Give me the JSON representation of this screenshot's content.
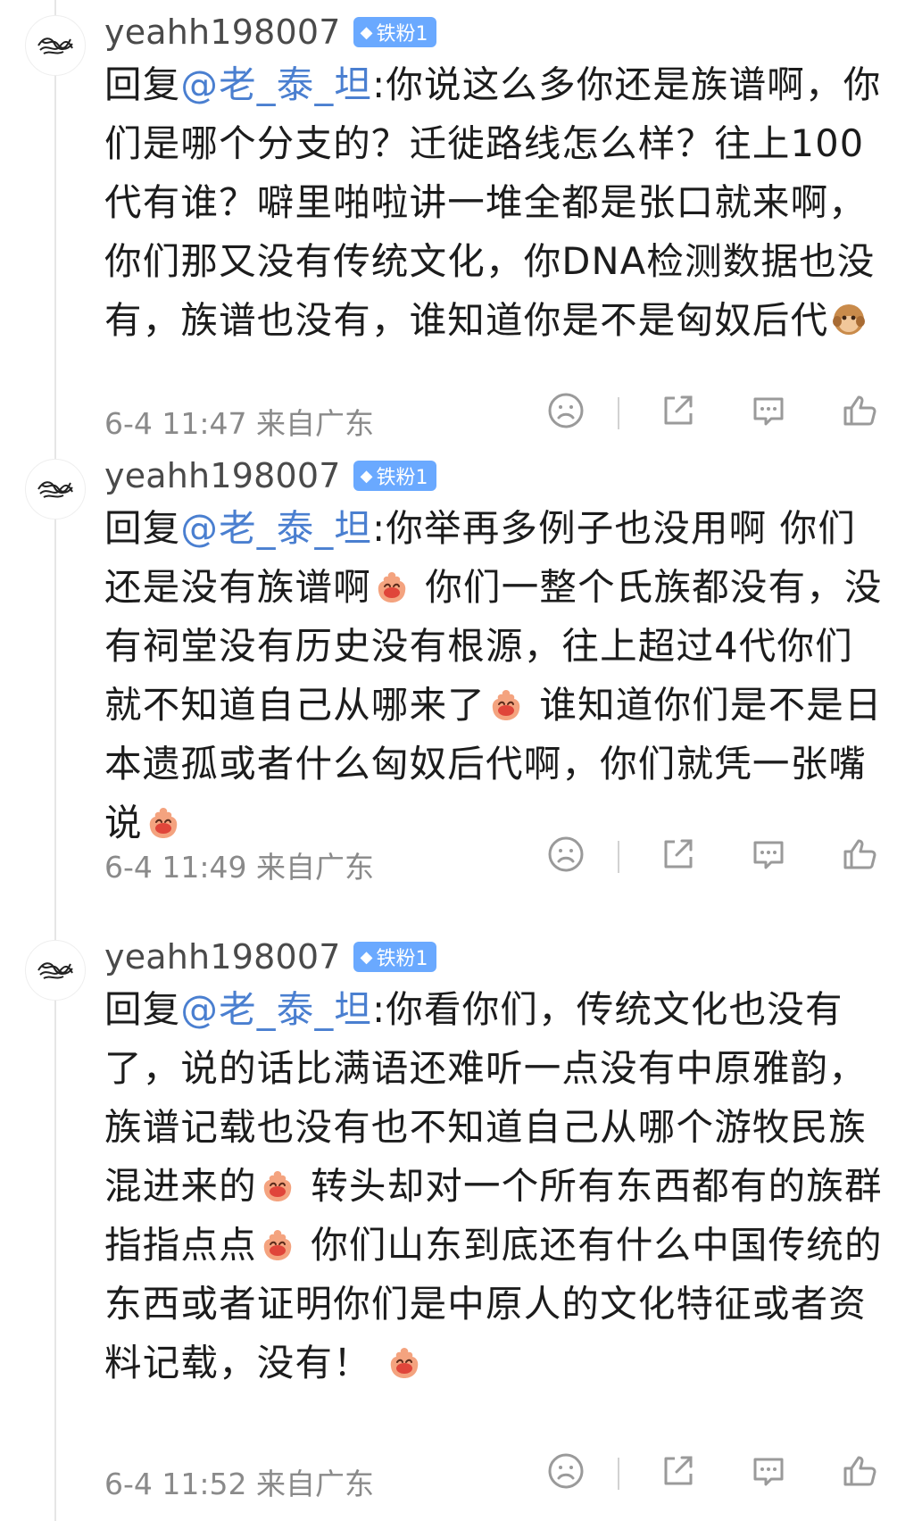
{
  "comments": [
    {
      "username": "yeahh198007",
      "badge": "铁粉1",
      "reply_prefix": "回复",
      "mention": "@老_泰_坦",
      "text_parts": [
        ":你说这么多你还是族谱啊，你们是哪个分支的？迁徙路线怎么样？往上100代有谁？噼里啪啦讲一堆全都是张口就来啊，你们那又没有传统文化，你DNA检测数据也没有，族谱也没有，谁知道你是不是匈奴后代"
      ],
      "emoji": [
        "monkey-emoji"
      ],
      "time": "6-4 11:47",
      "location": "来自广东"
    },
    {
      "username": "yeahh198007",
      "badge": "铁粉1",
      "reply_prefix": "回复",
      "mention": "@老_泰_坦",
      "text_parts": [
        ":你举再多例子也没用啊 你们还是没有族谱啊",
        " 你们一整个氏族都没有，没有祠堂没有历史没有根源，往上超过4代你们就不知道自己从哪来了",
        " 谁知道你们是不是日本遗孤或者什么匈奴后代啊，你们就凭一张嘴说",
        ""
      ],
      "emoji": [
        "laugh-emoji",
        "laugh-emoji",
        "laugh-emoji"
      ],
      "time": "6-4 11:49",
      "location": "来自广东"
    },
    {
      "username": "yeahh198007",
      "badge": "铁粉1",
      "reply_prefix": "回复",
      "mention": "@老_泰_坦",
      "text_parts": [
        ":你看你们，传统文化也没有了，说的话比满语还难听一点没有中原雅韵，族谱记载也没有也不知道自己从哪个游牧民族混进来的",
        " 转头却对一个所有东西都有的族群指指点点",
        " 你们山东到底还有什么中国传统的东西或者证明你们是中原人的文化特征或者资料记载，没有！ ",
        ""
      ],
      "emoji": [
        "laugh-emoji",
        "laugh-emoji",
        "laugh-emoji"
      ],
      "time": "6-4 11:52",
      "location": "来自广东"
    }
  ],
  "icons": {
    "reaction": "sad-face-icon",
    "share": "share-icon",
    "comment": "comment-icon",
    "like": "thumbs-up-icon"
  },
  "colors": {
    "mention": "#4a7fd0",
    "badge": "#6aa9ff",
    "meta": "#8a8a8a"
  }
}
